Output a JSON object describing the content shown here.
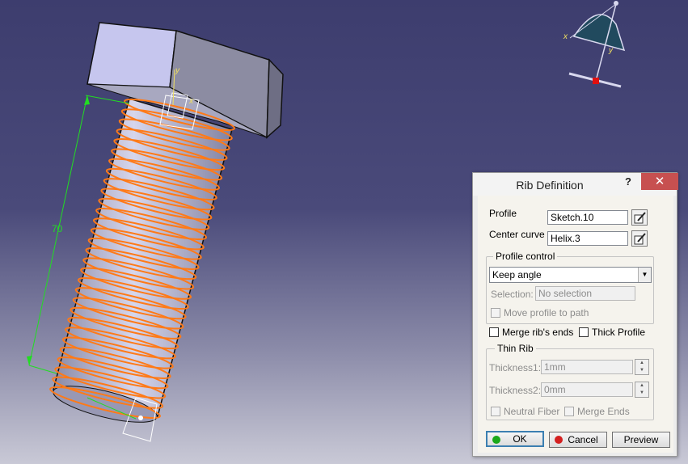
{
  "viewport": {
    "dimension_value": "70",
    "axis_y_label": "y",
    "axis_x_label": "x",
    "compass_x_label": "x",
    "compass_y_label": "y"
  },
  "dialog": {
    "title": "Rib Definition",
    "help_label": "?",
    "close_label": "✕",
    "profile_label": "Profile",
    "profile_value": "Sketch.10",
    "center_curve_label": "Center curve",
    "center_curve_value": "Helix.3",
    "profile_control": {
      "title": "Profile control",
      "mode_value": "Keep angle",
      "selection_label": "Selection:",
      "selection_value": "No selection",
      "move_profile_label": "Move profile to path"
    },
    "merge_ends_label": "Merge rib's ends",
    "thick_profile_label": "Thick Profile",
    "thin_rib": {
      "title": "Thin Rib",
      "thickness1_label": "Thickness1:",
      "thickness1_value": "1mm",
      "thickness2_label": "Thickness2:",
      "thickness2_value": "0mm",
      "neutral_fiber_label": "Neutral Fiber",
      "merge_ends_label": "Merge Ends"
    },
    "buttons": {
      "ok": "OK",
      "cancel": "Cancel",
      "preview": "Preview"
    },
    "colors": {
      "ok_led": "#1aa81a",
      "cancel_led": "#d42020",
      "close_bg": "#c75050"
    }
  }
}
